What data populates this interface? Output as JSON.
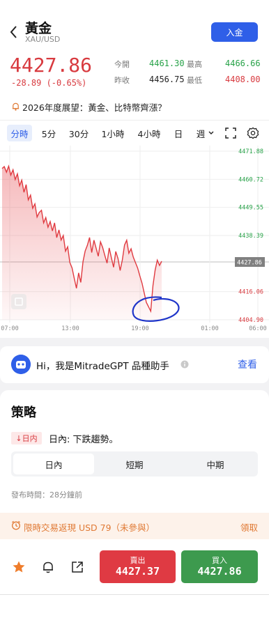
{
  "header": {
    "title": "黃金",
    "symbol": "XAU/USD",
    "deposit_label": "入金"
  },
  "quote": {
    "price": "4427.86",
    "change": "-28.89 (-0.65%)",
    "open_label": "今開",
    "open_value": "4461.30",
    "high_label": "最高",
    "high_value": "4466.66",
    "prev_close_label": "昨收",
    "prev_close_value": "4456.75",
    "low_label": "最低",
    "low_value": "4408.00"
  },
  "news": {
    "text": "2026年度展望：黃金、比特幣齊漲？"
  },
  "timeframes": {
    "items": [
      "分時",
      "5分",
      "30分",
      "1小時",
      "4小時",
      "日",
      "週"
    ],
    "active": "分時"
  },
  "chart_data": {
    "type": "area",
    "x_ticks": [
      "07:00",
      "13:00",
      "19:00",
      "01:00",
      "06:00"
    ],
    "y_ticks": [
      4471.88,
      4460.72,
      4449.55,
      4438.39,
      4427.86,
      4416.06,
      4404.9
    ],
    "current_price_label": "4427.86",
    "ylim": [
      4404.9,
      4471.88
    ],
    "grid": true,
    "series": [
      {
        "values": [
          4465,
          4466,
          4464,
          4466.5,
          4463,
          4465,
          4461,
          4463,
          4458,
          4460,
          4455,
          4458,
          4452,
          4454,
          4449,
          4451,
          4446,
          4448,
          4449,
          4444,
          4446,
          4442,
          4444,
          4440,
          4443,
          4437,
          4440,
          4436,
          4438,
          4432,
          4434,
          4428,
          4426,
          4422,
          4418,
          4424,
          4420,
          4428,
          4432,
          4434,
          4437,
          4431,
          4436,
          4433,
          4430,
          4436,
          4434,
          4431,
          4428,
          4434,
          4430,
          4426,
          4432,
          4429,
          4424,
          4428,
          4434,
          4436,
          4431,
          4433,
          4430,
          4428,
          4426,
          4423,
          4420,
          4416,
          4412,
          4410,
          4408,
          4418,
          4424,
          4428,
          4426,
          4427.86
        ]
      }
    ]
  },
  "gpt": {
    "text": "Hi，我是MitradeGPT 品種助手",
    "link": "查看"
  },
  "strategy": {
    "title": "策略",
    "badge": "日内",
    "description": "日內: 下跌趨勢。",
    "segments": [
      "日內",
      "短期",
      "中期"
    ],
    "active_segment": "日內",
    "publish": "發布時間：28分鐘前"
  },
  "promo": {
    "text": "限時交易返現 USD 79（未參與）",
    "link": "領取"
  },
  "trade": {
    "sell_label": "賣出",
    "sell_price": "4427.37",
    "buy_label": "買入",
    "buy_price": "4427.86"
  },
  "colors": {
    "accent": "#2f5fe8",
    "up": "#27a248",
    "down": "#d83a3f",
    "promo": "#e07a35"
  },
  "icons": [
    "back-icon",
    "bell-icon",
    "fullscreen-icon",
    "settings-icon",
    "star-icon",
    "share-icon",
    "alarm-icon",
    "info-icon"
  ]
}
